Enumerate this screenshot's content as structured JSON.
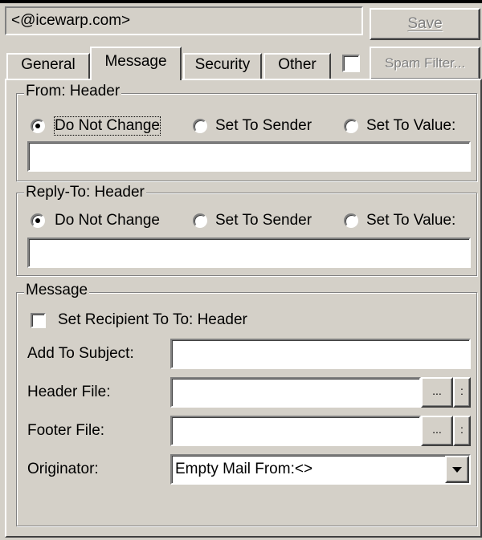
{
  "header": {
    "account_value": "<@icewarp.com>",
    "save_label": "Save",
    "spam_filter_label": "Spam Filter..."
  },
  "tabs": [
    {
      "label": "General"
    },
    {
      "label": "Message"
    },
    {
      "label": "Security"
    },
    {
      "label": "Other"
    }
  ],
  "from_header": {
    "title": "From: Header",
    "options": [
      "Do Not Change",
      "Set To Sender",
      "Set To Value:"
    ],
    "selected": "Do Not Change",
    "value": ""
  },
  "reply_to_header": {
    "title": "Reply-To: Header",
    "options": [
      "Do Not Change",
      "Set To Sender",
      "Set To Value:"
    ],
    "selected": "Do Not Change",
    "value": ""
  },
  "message": {
    "title": "Message",
    "set_recipient_label": "Set Recipient To To: Header",
    "add_to_subject_label": "Add To Subject:",
    "add_to_subject_value": "",
    "header_file_label": "Header File:",
    "header_file_value": "",
    "footer_file_label": "Footer File:",
    "footer_file_value": "",
    "browse_label": "...",
    "edit_label": ":",
    "originator_label": "Originator:",
    "originator_value": "Empty Mail From:<>"
  }
}
